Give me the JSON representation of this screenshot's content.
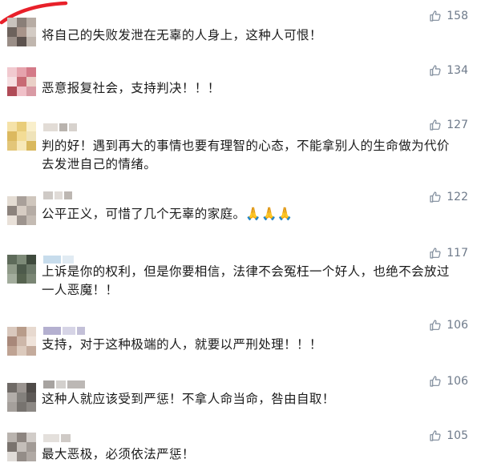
{
  "colors": {
    "like": "#7d8a9a",
    "scribble": "#e8202a",
    "text": "#1a1a1a"
  },
  "comments": [
    {
      "text": "将自己的失败发泄在无辜的人身上，这种人可恨！",
      "likes": "158",
      "icon": "thumbs-up-icon"
    },
    {
      "text": "恶意报复社会，支持判决！！！",
      "likes": "134",
      "icon": "thumbs-up-icon"
    },
    {
      "text": "判的好！遇到再大的事情也要有理智的心态，不能拿别人的生命做为代价去发泄自己的情绪。",
      "likes": "127",
      "icon": "thumbs-up-icon"
    },
    {
      "text": "公平正义，可惜了几个无辜的家庭。🙏🙏🙏",
      "likes": "122",
      "icon": "thumbs-up-icon"
    },
    {
      "text": "上诉是你的权利，但是你要相信，法律不会冤枉一个好人，也绝不会放过一人恶魔！！",
      "likes": "117",
      "icon": "thumbs-up-icon"
    },
    {
      "text": "支持，对于这种极端的人，就要以严刑处理！！！",
      "likes": "106",
      "icon": "thumbs-up-icon"
    },
    {
      "text": "这种人就应该受到严惩！不拿人命当命，咎由自取！",
      "likes": "106",
      "icon": "thumbs-up-icon"
    },
    {
      "text": "最大恶极，必须依法严惩！",
      "likes": "105",
      "icon": "thumbs-up-icon"
    }
  ]
}
